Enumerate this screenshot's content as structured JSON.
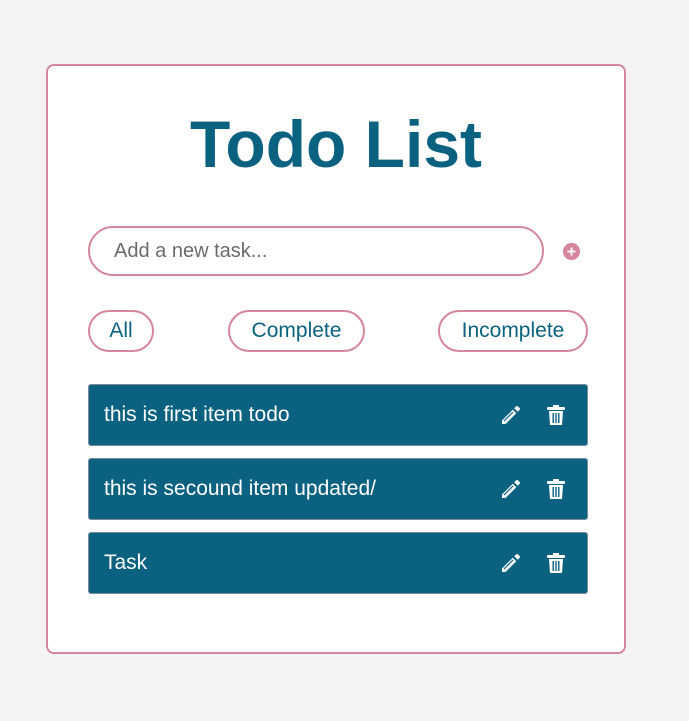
{
  "app": {
    "title": "Todo List"
  },
  "input": {
    "placeholder": "Add a new task...",
    "value": "",
    "add_icon": "plus-circle-icon"
  },
  "filters": [
    {
      "label": "All"
    },
    {
      "label": "Complete"
    },
    {
      "label": "Incomplete"
    }
  ],
  "todos": [
    {
      "text": "this is first item todo",
      "edit_icon": "pencil-icon",
      "delete_icon": "trash-icon"
    },
    {
      "text": "this is secound item updated/",
      "edit_icon": "pencil-icon",
      "delete_icon": "trash-icon"
    },
    {
      "text": "Task",
      "edit_icon": "pencil-icon",
      "delete_icon": "trash-icon"
    }
  ],
  "colors": {
    "background": "#f3f3f3",
    "card": "#ffffff",
    "accent_border": "#d4869c",
    "primary": "#0a6280",
    "item_text": "#ffffff"
  }
}
